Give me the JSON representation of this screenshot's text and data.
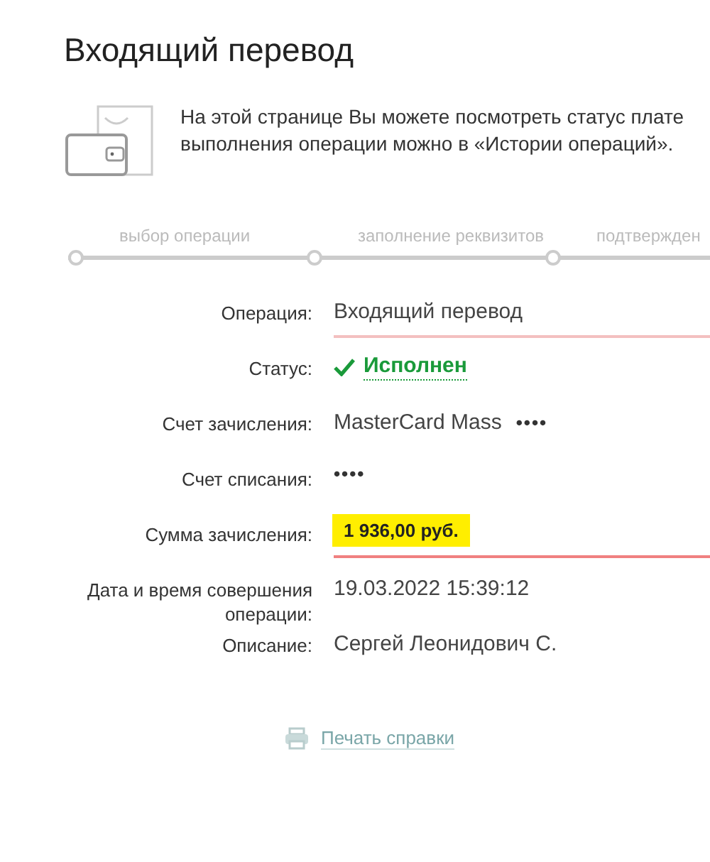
{
  "title": "Входящий перевод",
  "info": {
    "lines": [
      "На этой странице Вы можете посмотреть статус плате",
      "выполнения операции можно в «Истории операций»."
    ]
  },
  "steps": [
    "выбор операции",
    "заполнение реквизитов",
    "подтвержден"
  ],
  "details": [
    {
      "label": "Операция:",
      "value": "Входящий перевод",
      "kind": "underlined"
    },
    {
      "label": "Статус:",
      "value": "Исполнен",
      "kind": "status"
    },
    {
      "label": "Счет зачисления:",
      "value": "MasterCard Mass",
      "masked": "••••",
      "kind": "plain"
    },
    {
      "label": "Счет списания:",
      "masked": "••••",
      "kind": "plain"
    },
    {
      "label": "Сумма зачисления:",
      "value": "1 936,00 руб.",
      "kind": "amount"
    },
    {
      "label": "Дата и время совершения операции:",
      "value": "19.03.2022 15:39:12",
      "kind": "plain"
    },
    {
      "label": "Описание:",
      "value": "Сергей Леонидович С.",
      "kind": "plain"
    }
  ],
  "print_link": "Печать справки"
}
